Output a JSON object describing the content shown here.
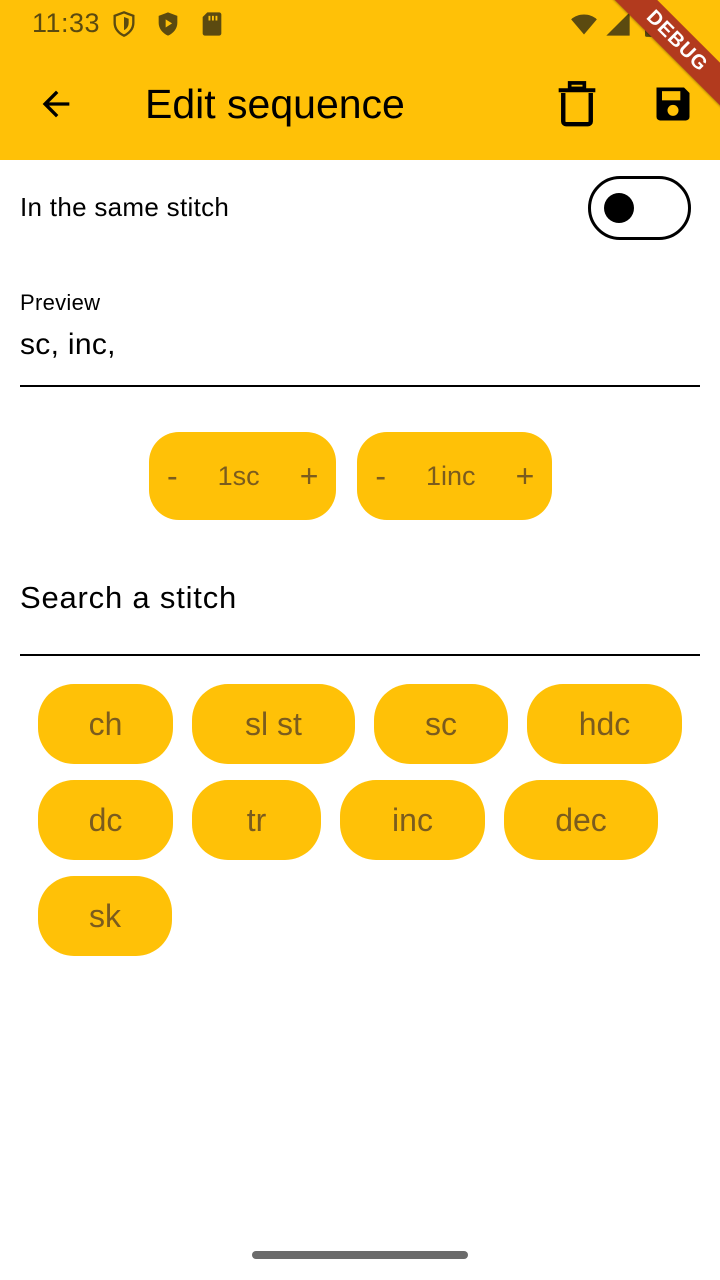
{
  "status_bar": {
    "time": "11:33",
    "left_icons": [
      "shield-icon",
      "play-protect-icon",
      "sd-card-icon"
    ],
    "right_icons": [
      "wifi-icon",
      "signal-icon",
      "battery-icon"
    ]
  },
  "debug_banner": "DEBUG",
  "app_bar": {
    "title": "Edit sequence",
    "back_icon": "arrow-back-icon",
    "actions": [
      "delete-icon",
      "save-icon"
    ],
    "background_color": "#FFC107"
  },
  "same_stitch": {
    "label": "In the same stitch",
    "enabled": false
  },
  "preview": {
    "label": "Preview",
    "value": "sc, inc,"
  },
  "counters": [
    {
      "minus": "-",
      "value": "1sc",
      "plus": "+"
    },
    {
      "minus": "-",
      "value": "1inc",
      "plus": "+"
    }
  ],
  "search": {
    "placeholder": "Search a stitch"
  },
  "stitches": [
    "ch",
    "sl st",
    "sc",
    "hdc",
    "dc",
    "tr",
    "inc",
    "dec",
    "sk"
  ],
  "colors": {
    "accent": "#FFC107",
    "chip_text": "#7b5c1e"
  }
}
